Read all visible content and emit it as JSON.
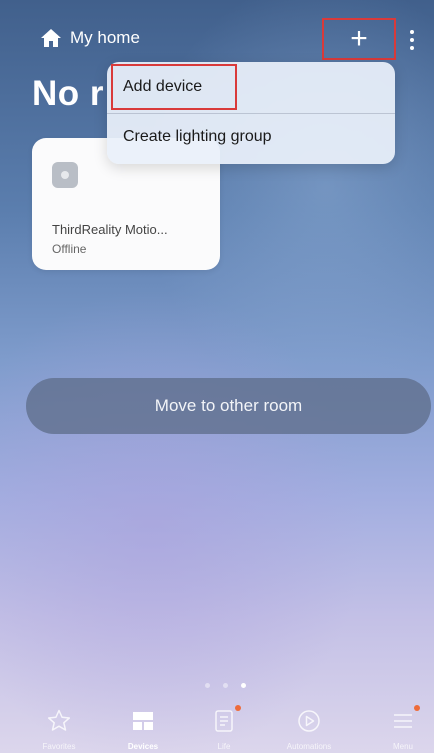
{
  "header": {
    "home_label": "My home",
    "plus_symbol": "+",
    "room_title": "No r"
  },
  "menu": {
    "items": [
      {
        "label": "Add device"
      },
      {
        "label": "Create lighting group"
      }
    ]
  },
  "device": {
    "name": "ThirdReality Motio...",
    "status": "Offline",
    "icon": "device-icon"
  },
  "actions": {
    "move_room": "Move to other room"
  },
  "pager": {
    "count": 3,
    "active_index": 2
  },
  "nav": {
    "items": [
      {
        "label": "Favorites",
        "icon": "star-icon",
        "active": false,
        "badge": false
      },
      {
        "label": "Devices",
        "icon": "devices-grid-icon",
        "active": true,
        "badge": false
      },
      {
        "label": "Life",
        "icon": "life-card-icon",
        "active": false,
        "badge": true
      },
      {
        "label": "Automations",
        "icon": "play-circle-icon",
        "active": false,
        "badge": false
      },
      {
        "label": "Menu",
        "icon": "hamburger-icon",
        "active": false,
        "badge": true
      }
    ]
  },
  "colors": {
    "highlight_border": "#d93a3a",
    "badge": "#ee6b3a"
  }
}
